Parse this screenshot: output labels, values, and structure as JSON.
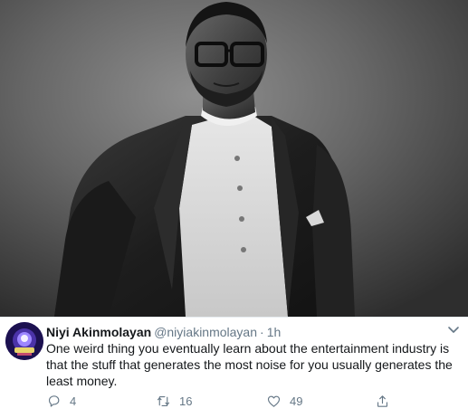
{
  "tweet": {
    "author": {
      "display_name": "Niyi Akinmolayan",
      "handle": "@niyiakinmolayan",
      "separator": "·",
      "time": "1h"
    },
    "text": "One weird thing you eventually learn about the entertainment industry is that the stuff that generates the most noise for you usually generates the least money.",
    "actions": {
      "reply_count": "4",
      "retweet_count": "16",
      "like_count": "49"
    }
  },
  "icons": {
    "avatar": "profile-avatar",
    "menu": "chevron-down-icon",
    "reply": "reply-icon",
    "retweet": "retweet-icon",
    "like": "heart-icon",
    "share": "share-icon"
  },
  "colors": {
    "text_primary": "#14171a",
    "text_secondary": "#657786",
    "background": "#ffffff"
  }
}
